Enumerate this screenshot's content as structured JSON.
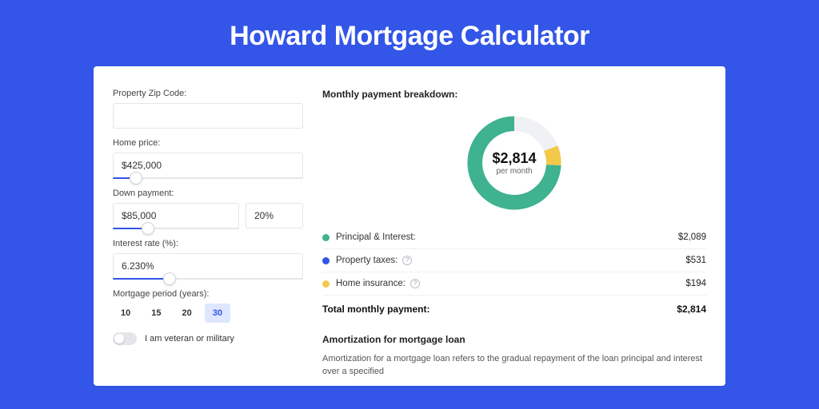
{
  "page": {
    "title": "Howard Mortgage Calculator"
  },
  "form": {
    "zip": {
      "label": "Property Zip Code:",
      "value": ""
    },
    "home_price": {
      "label": "Home price:",
      "value": "$425,000",
      "slider_pct": 12
    },
    "down_payment": {
      "label": "Down payment:",
      "amount": "$85,000",
      "percent": "20%",
      "slider_pct": 28
    },
    "interest_rate": {
      "label": "Interest rate (%):",
      "value": "6.230%",
      "slider_pct": 30
    },
    "period": {
      "label": "Mortgage period (years):",
      "options": [
        "10",
        "15",
        "20",
        "30"
      ],
      "selected": "30"
    },
    "veteran": {
      "label": "I am veteran or military",
      "on": false
    }
  },
  "breakdown": {
    "title": "Monthly payment breakdown:",
    "center_value": "$2,814",
    "center_sub": "per month",
    "rows": [
      {
        "color": "#3fb28f",
        "label": "Principal & Interest:",
        "value": "$2,089",
        "info": false
      },
      {
        "color": "#3355e8",
        "label": "Property taxes:",
        "value": "$531",
        "info": true
      },
      {
        "color": "#f3c84b",
        "label": "Home insurance:",
        "value": "$194",
        "info": true
      }
    ],
    "total_label": "Total monthly payment:",
    "total_value": "$2,814"
  },
  "chart_data": {
    "type": "pie",
    "title": "Monthly payment breakdown",
    "series": [
      {
        "name": "Principal & Interest",
        "value": 2089,
        "color": "#3fb28f"
      },
      {
        "name": "Property taxes",
        "value": 531,
        "color": "#3355e8"
      },
      {
        "name": "Home insurance",
        "value": 194,
        "color": "#f3c84b"
      }
    ],
    "total": 2814,
    "center_label": "$2,814 per month"
  },
  "amortization": {
    "title": "Amortization for mortgage loan",
    "body": "Amortization for a mortgage loan refers to the gradual repayment of the loan principal and interest over a specified"
  }
}
